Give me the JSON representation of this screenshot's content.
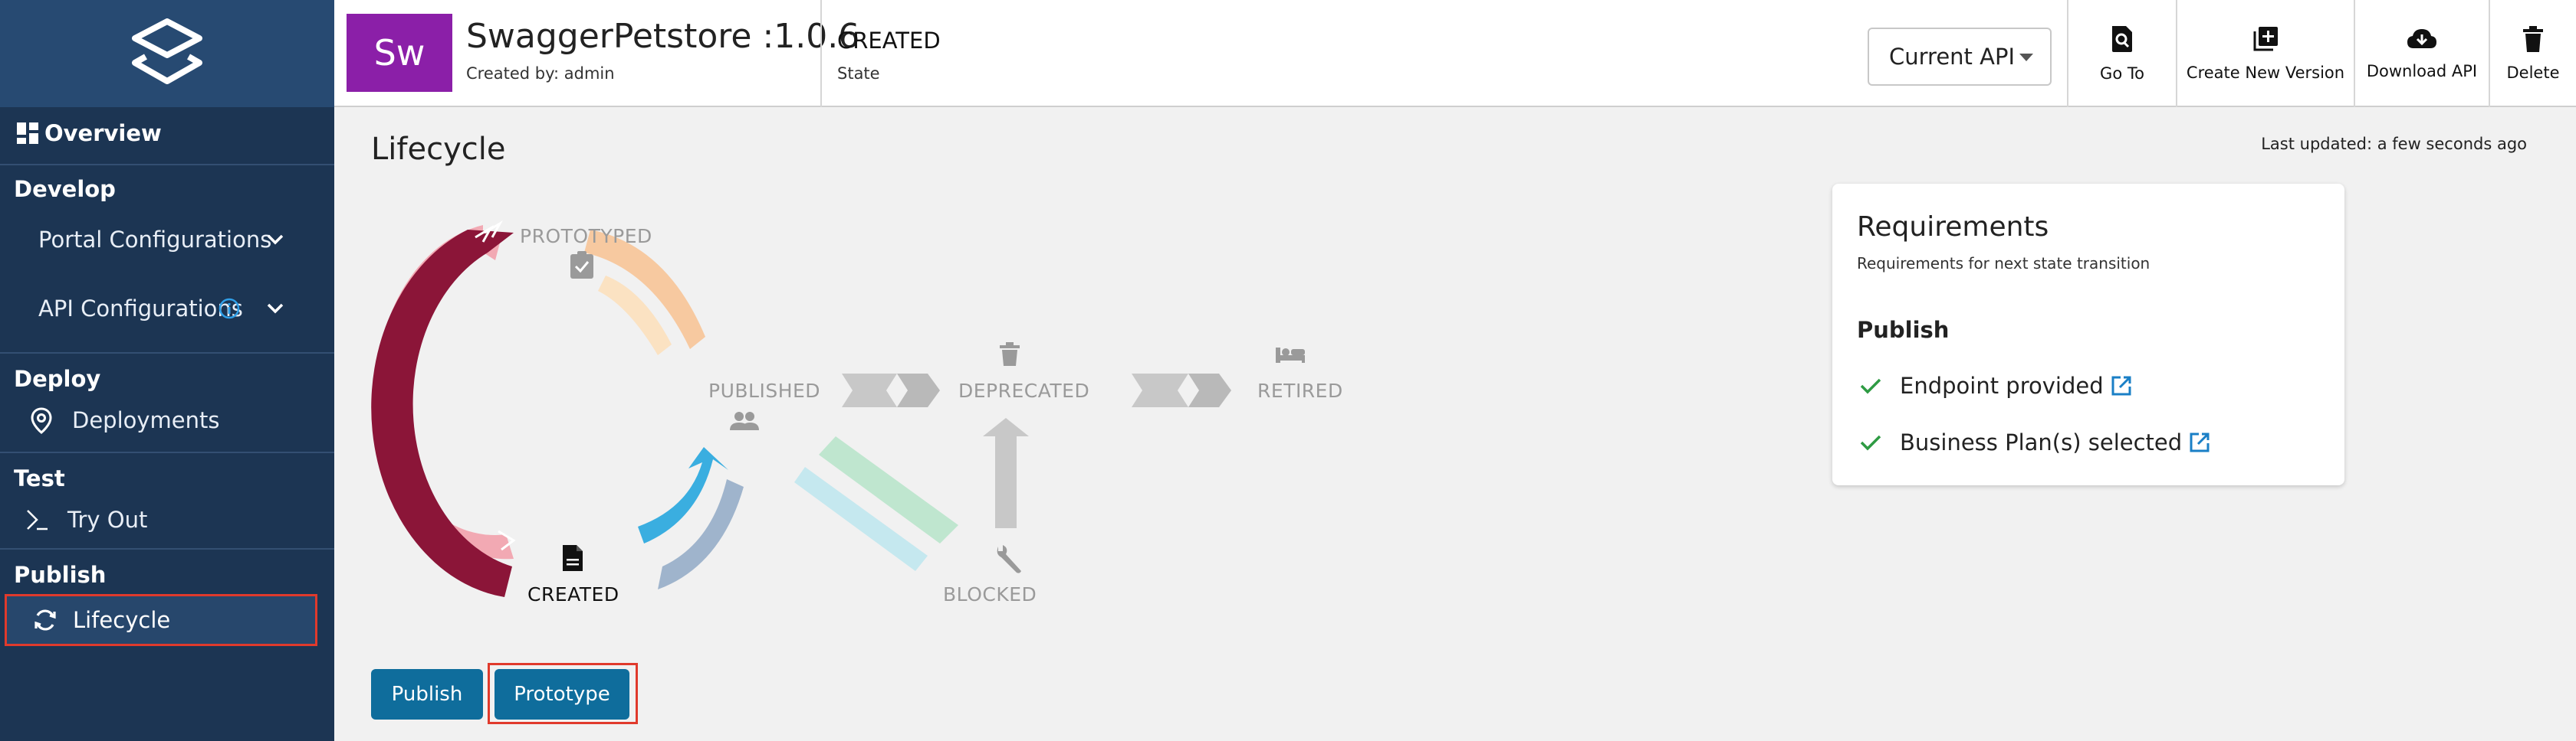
{
  "sidebar": {
    "overview": "Overview",
    "develop_title": "Develop",
    "portal_config": "Portal Configurations",
    "api_config": "API Configurations",
    "deploy_title": "Deploy",
    "deployments": "Deployments",
    "test_title": "Test",
    "try_out": "Try Out",
    "publish_title": "Publish",
    "lifecycle": "Lifecycle"
  },
  "header": {
    "avatar_initials": "Sw",
    "api_name": "SwaggerPetstore :1.0.6",
    "created_by": "Created by: admin",
    "state_value": "CREATED",
    "state_label": "State",
    "api_select": "Current API",
    "go_to": "Go To",
    "create_new_version": "Create New Version",
    "download_api": "Download API",
    "delete": "Delete"
  },
  "main": {
    "title": "Lifecycle",
    "last_updated": "Last updated: a few seconds ago",
    "states": {
      "prototyped": "PROTOTYPED",
      "published": "PUBLISHED",
      "deprecated": "DEPRECATED",
      "retired": "RETIRED",
      "created": "CREATED",
      "blocked": "BLOCKED"
    },
    "buttons": {
      "publish": "Publish",
      "prototype": "Prototype"
    }
  },
  "requirements": {
    "title": "Requirements",
    "subtitle": "Requirements for next state transition",
    "section": "Publish",
    "items": [
      "Endpoint provided",
      "Business Plan(s) selected"
    ]
  },
  "colors": {
    "sidebar_bg": "#1c3553",
    "logo_bg": "#274a72",
    "accent_button": "#0f6d9c",
    "highlight_border": "#e03a2c",
    "avatar_bg": "#8b1fa8",
    "check_green": "#2e9b43",
    "link_blue": "#1a7fc6"
  }
}
